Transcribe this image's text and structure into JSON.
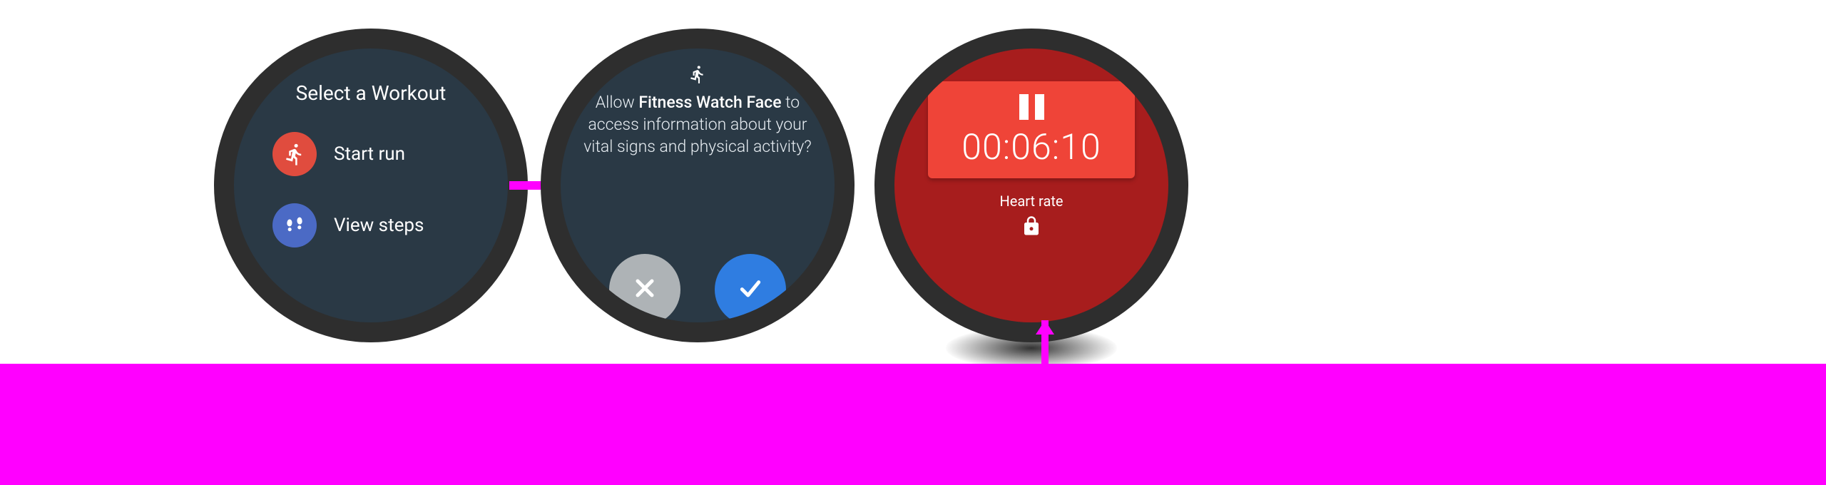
{
  "watch1": {
    "title": "Select a Workout",
    "items": [
      {
        "icon": "run",
        "label": "Start run"
      },
      {
        "icon": "steps",
        "label": "View steps"
      }
    ]
  },
  "watch2": {
    "permission": {
      "prefix": "Allow ",
      "app_name": "Fitness Watch Face",
      "suffix": " to access information about your vital signs and physical activity?"
    }
  },
  "watch3": {
    "timer": "00:06:10",
    "heart_rate_label": "Heart rate"
  }
}
